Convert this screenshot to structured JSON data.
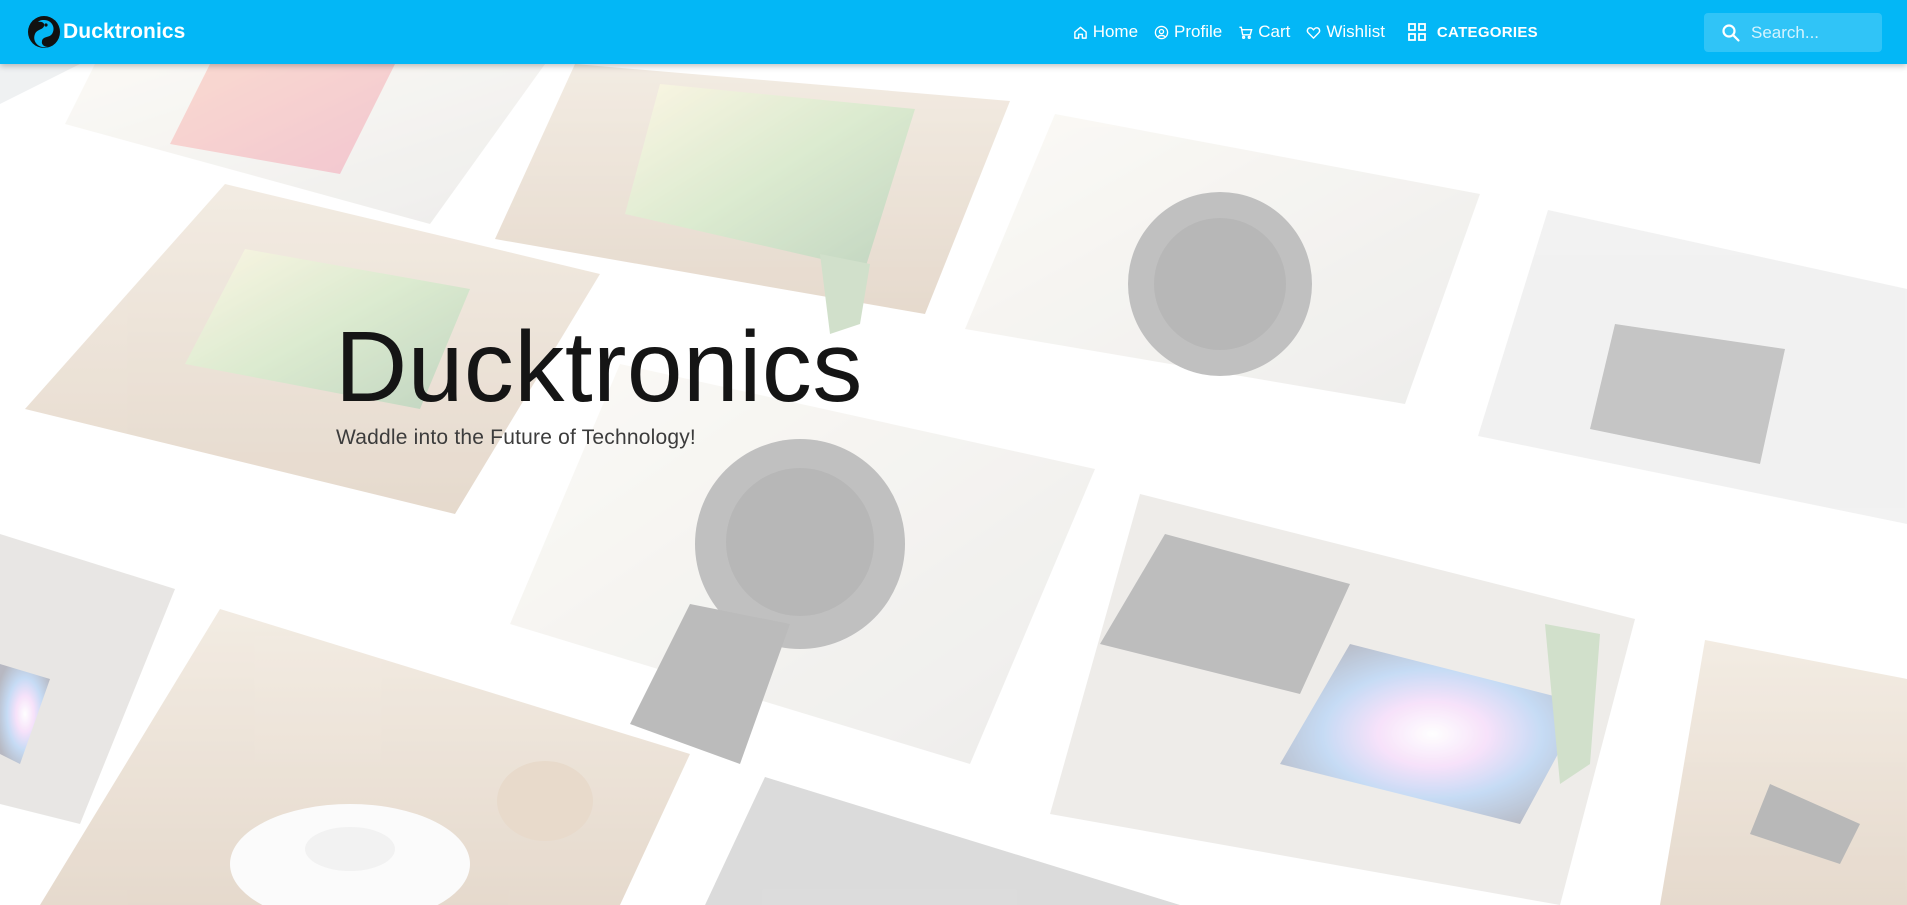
{
  "header": {
    "brand_name": "Ducktronics",
    "logo_icon": "duck-logo-icon",
    "accent_color": "#03b7f6",
    "nav": [
      {
        "label": "Home",
        "icon": "home-icon"
      },
      {
        "label": "Profile",
        "icon": "user-circle-icon"
      },
      {
        "label": "Cart",
        "icon": "cart-icon"
      },
      {
        "label": "Wishlist",
        "icon": "heart-icon"
      },
      {
        "label": "CATEGORIES",
        "icon": "grid-icon"
      }
    ],
    "search": {
      "placeholder": "Search...",
      "value": "",
      "icon": "search-icon"
    }
  },
  "hero": {
    "title": "Ducktronics",
    "subtitle": "Waddle into the Future of Technology!",
    "background_images": [
      "phone",
      "television",
      "smartwatch",
      "charger",
      "television",
      "smartwatch",
      "laptop",
      "keychain-tracker",
      "laptop",
      "desk-lamp",
      "plant"
    ]
  }
}
